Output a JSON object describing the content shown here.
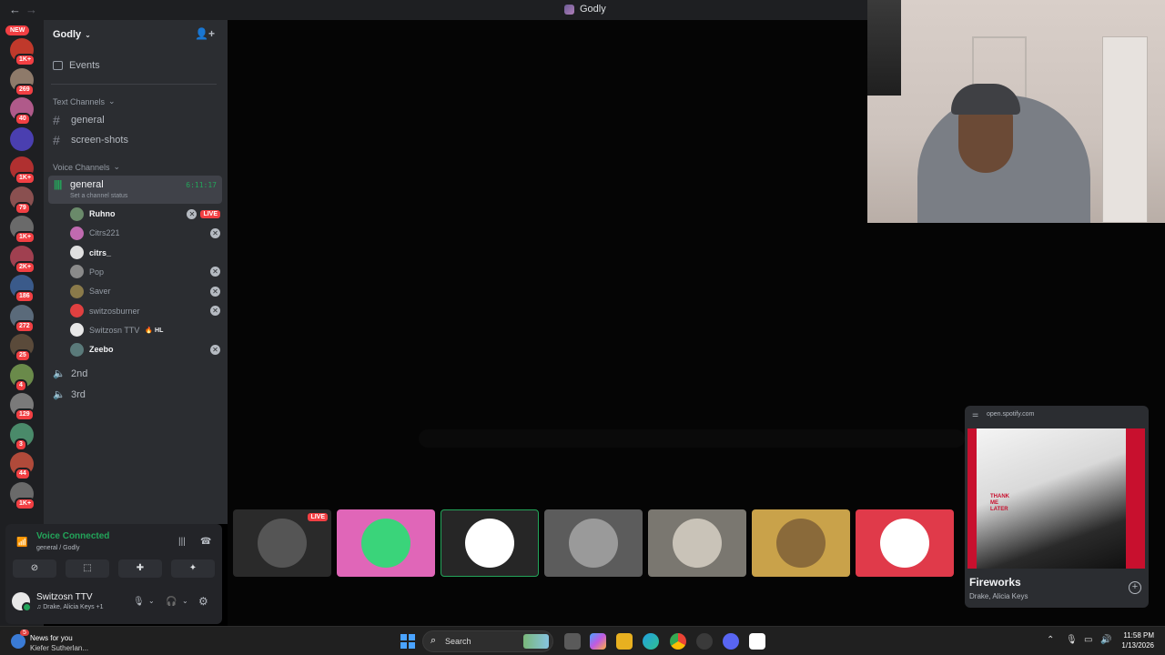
{
  "window": {
    "title": "Godly",
    "back_glyph": "←",
    "forward_glyph": "→"
  },
  "rail": {
    "new_badge": "NEW",
    "servers": [
      {
        "badge": "1K+",
        "color": "#c0392b"
      },
      {
        "badge": "269",
        "color": "#8e7a6a"
      },
      {
        "badge": "40",
        "color": "#b05a8a"
      },
      {
        "badge": "",
        "color": "#4a3fb0"
      },
      {
        "badge": "1K+",
        "color": "#b03030"
      },
      {
        "badge": "79",
        "color": "#8a5050"
      },
      {
        "badge": "1K+",
        "color": "#6a6a6a"
      },
      {
        "badge": "2K+",
        "color": "#a04050"
      },
      {
        "badge": "186",
        "color": "#3a5a8a"
      },
      {
        "badge": "272",
        "color": "#5a6a7a"
      },
      {
        "badge": "25",
        "color": "#5a4a3a"
      },
      {
        "badge": "4",
        "color": "#6a8a4a"
      },
      {
        "badge": "129",
        "color": "#7a7a7a"
      },
      {
        "badge": "3",
        "color": "#4a8a6a"
      },
      {
        "badge": "44",
        "color": "#b04a3a"
      },
      {
        "badge": "1K+",
        "color": "#6a6a6a"
      }
    ]
  },
  "server": {
    "name": "Godly",
    "chevron": "⌄",
    "invite_icon": "👤+"
  },
  "sidebar": {
    "events_label": "Events",
    "text_category": "Text Channels",
    "text_channels": [
      "general",
      "screen-shots"
    ],
    "voice_category": "Voice Channels",
    "active_voice": {
      "name": "general",
      "time": "6:11:17",
      "status": "Set a channel status"
    },
    "members": [
      {
        "name": "Ruhno",
        "bold": true,
        "live": true,
        "xbox": true,
        "color": "#6a8a6a"
      },
      {
        "name": "Citrs221",
        "bold": false,
        "live": false,
        "xbox": true,
        "color": "#c06ab0"
      },
      {
        "name": "citrs_",
        "bold": true,
        "live": false,
        "xbox": false,
        "color": "#e0e0e0"
      },
      {
        "name": "Pop",
        "bold": false,
        "live": false,
        "xbox": true,
        "color": "#8a8a8a"
      },
      {
        "name": "Saver",
        "bold": false,
        "live": false,
        "xbox": true,
        "color": "#8a7a4a"
      },
      {
        "name": "switzosburner",
        "bold": false,
        "live": false,
        "xbox": true,
        "color": "#e04040"
      },
      {
        "name": "Switzosn TTV",
        "bold": false,
        "live": false,
        "xbox": false,
        "color": "#e8e8e8",
        "tag": "🔥 HL"
      },
      {
        "name": "Zeebo",
        "bold": true,
        "live": false,
        "xbox": true,
        "color": "#5a7a7a"
      }
    ],
    "live_label": "LIVE",
    "other_voice": [
      "2nd",
      "3rd"
    ]
  },
  "voice_panel": {
    "status": "Voice Connected",
    "location": "general / Godly",
    "user_name": "Switzosn TTV",
    "activity": "♫ Drake, Alicia Keys +1"
  },
  "stage": {
    "thumb_live": "LIVE",
    "thumbs": [
      {
        "bg": "#2a2a2a",
        "circle": "#555555",
        "live": true
      },
      {
        "bg": "#e066b8",
        "circle": "#3ad47a"
      },
      {
        "bg": "#262626",
        "circle": "#ffffff",
        "border": "#23a55a"
      },
      {
        "bg": "#5c5c5c",
        "circle": "#9a9a9a"
      },
      {
        "bg": "#7a7770",
        "circle": "#c9c3b8"
      },
      {
        "bg": "#c9a24a",
        "circle": "#8a6a3a"
      },
      {
        "bg": "#e03a4a",
        "circle": "#ffffff"
      }
    ]
  },
  "spotify": {
    "url": "open.spotify.com",
    "song": "Fireworks",
    "artist": "Drake, Alicia Keys",
    "album_text": "THANK ME LATER"
  },
  "taskbar": {
    "news_title": "News for you",
    "news_sub": "Kiefer Sutherlan...",
    "news_badge": "5",
    "search_placeholder": "Search",
    "time": "11:58 PM",
    "date": "1/13/2026"
  }
}
